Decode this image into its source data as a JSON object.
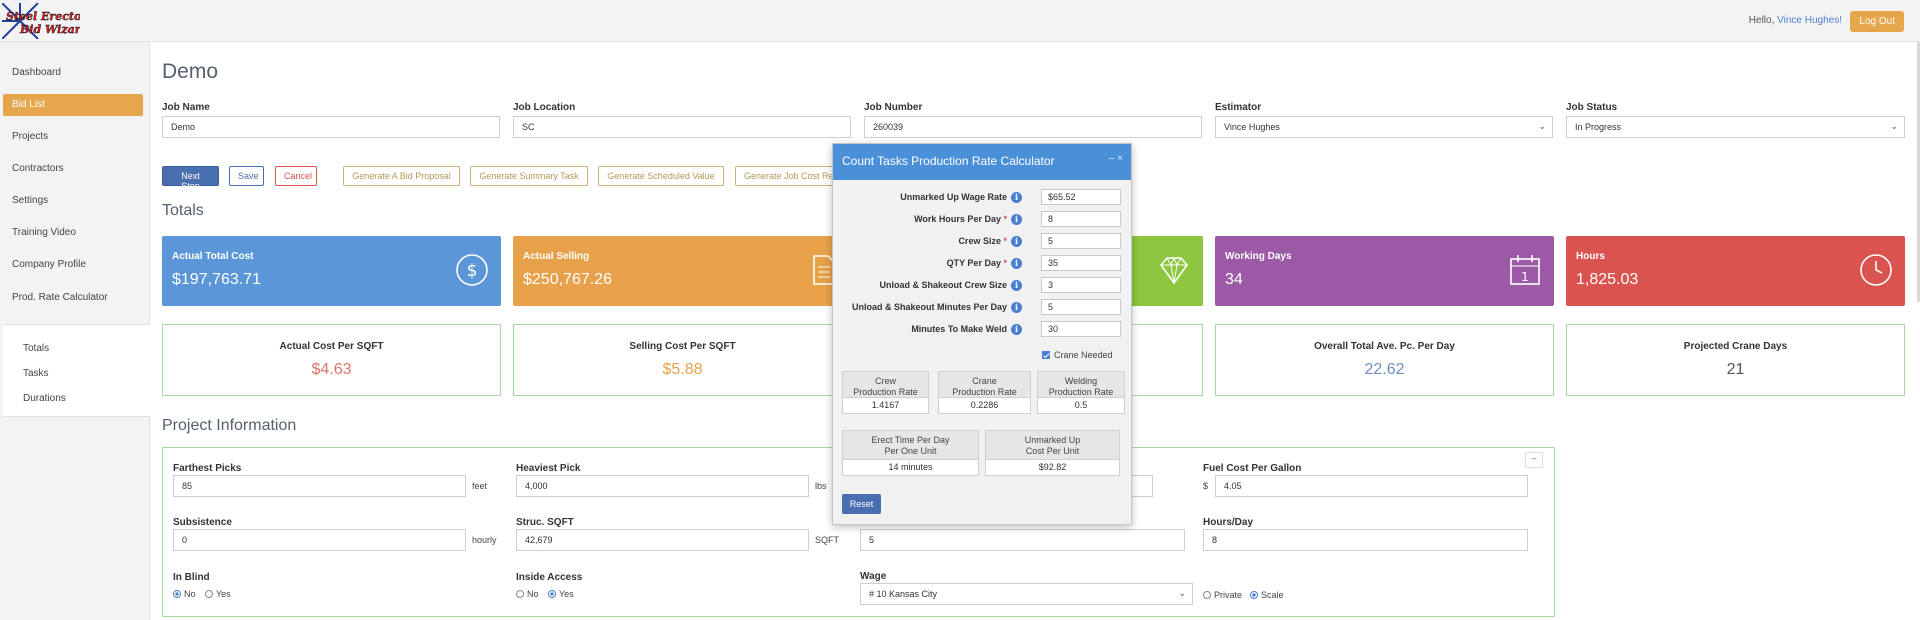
{
  "header": {
    "hello_prefix": "Hello, ",
    "user_name": "Vince Hughes!",
    "logout": "Log Out",
    "logo_text": "Steel Erectors Bid Wizard"
  },
  "sidebar": {
    "items": [
      {
        "label": "Dashboard"
      },
      {
        "label": "Bid List"
      },
      {
        "label": "Projects"
      },
      {
        "label": "Contractors"
      },
      {
        "label": "Settings"
      },
      {
        "label": "Training Video"
      },
      {
        "label": "Company Profile"
      },
      {
        "label": "Prod. Rate Calculator"
      }
    ],
    "sub_items": [
      {
        "label": "Totals"
      },
      {
        "label": "Tasks"
      },
      {
        "label": "Durations"
      }
    ]
  },
  "page": {
    "title": "Demo",
    "fields": {
      "job_name": {
        "label": "Job Name",
        "value": "Demo"
      },
      "job_location": {
        "label": "Job Location",
        "value": "SC"
      },
      "job_number": {
        "label": "Job Number",
        "value": "260039"
      },
      "estimator": {
        "label": "Estimator",
        "value": "Vince Hughes"
      },
      "job_status": {
        "label": "Job Status",
        "value": "In Progress"
      }
    },
    "buttons": {
      "next_step": "Next Step",
      "save": "Save",
      "cancel": "Cancel",
      "gen_bid": "Generate A Bid Proposal",
      "gen_summary": "Generate Summary Task",
      "gen_scheduled": "Generate Scheduled Value",
      "gen_job_cost": "Generate Job Cost Re"
    },
    "totals_title": "Totals",
    "cards": [
      {
        "title": "Actual Total Cost",
        "value": "$197,763.71",
        "color": "#5b97d8",
        "icon": "dollar-icon"
      },
      {
        "title": "Actual Selling",
        "value": "$250,767.26",
        "color": "#e6a14a",
        "icon": "document-icon"
      },
      {
        "title": "",
        "value": "",
        "color": "#8dc63f",
        "icon": "diamond-icon"
      },
      {
        "title": "Working Days",
        "value": "34",
        "color": "#9b59a6",
        "icon": "calendar-icon"
      },
      {
        "title": "Hours",
        "value": "1,825.03",
        "color": "#d9534f",
        "icon": "clock-icon"
      }
    ],
    "stats": [
      {
        "title": "Actual Cost Per SQFT",
        "value": "$4.63",
        "color": "#d9746a"
      },
      {
        "title": "Selling Cost Per SQFT",
        "value": "$5.88",
        "color": "#e6a14a"
      },
      {
        "title": "Overall Total Ave. Pc. Per Day",
        "value": "22.62",
        "color": "#6b8fbf"
      },
      {
        "title": "Projected Crane Days",
        "value": "21",
        "color": "#555555"
      }
    ],
    "project_info": {
      "title": "Project Information",
      "collapse": "–",
      "farthest_picks": {
        "label": "Farthest Picks",
        "value": "85",
        "unit": "feet"
      },
      "heaviest_pick": {
        "label": "Heaviest Pick",
        "value": "4,000",
        "unit": "lbs"
      },
      "fuel_cost": {
        "label": "Fuel Cost Per Gallon",
        "value": "4.05",
        "prefix": "$"
      },
      "subsistence": {
        "label": "Subsistence",
        "value": "0",
        "unit": "hourly"
      },
      "struc_sqft": {
        "label": "Struc. SQFT",
        "value": "42,679",
        "unit": "SQFT"
      },
      "third_value": {
        "value": "5"
      },
      "hours_day": {
        "label": "Hours/Day",
        "value": "8"
      },
      "in_blind": {
        "label": "In Blind",
        "no": "No",
        "yes": "Yes"
      },
      "inside_access": {
        "label": "Inside Access",
        "no": "No",
        "yes": "Yes"
      },
      "wage": {
        "label": "Wage",
        "value": "# 10 Kansas City",
        "private": "Private",
        "scale": "Scale"
      }
    }
  },
  "modal": {
    "title": "Count Tasks Production Rate Calculator",
    "controls": "– ×",
    "rows": [
      {
        "label": "Unmarked Up Wage Rate",
        "required": false,
        "value": "$65.52"
      },
      {
        "label": "Work Hours Per Day",
        "required": true,
        "value": "8"
      },
      {
        "label": "Crew Size",
        "required": true,
        "value": "5"
      },
      {
        "label": "QTY Per Day",
        "required": true,
        "value": "35"
      },
      {
        "label": "Unload & Shakeout Crew Size",
        "required": false,
        "value": "3"
      },
      {
        "label": "Unload & Shakeout Minutes Per Day",
        "required": false,
        "value": "5"
      },
      {
        "label": "Minutes To Make Weld",
        "required": false,
        "value": "30"
      }
    ],
    "crane_needed": "Crane Needed",
    "results": [
      {
        "l1": "Crew",
        "l2": "Production Rate",
        "value": "1.4167"
      },
      {
        "l1": "Crane",
        "l2": "Production Rate",
        "value": "0.2286"
      },
      {
        "l1": "Welding",
        "l2": "Production Rate",
        "value": "0.5"
      }
    ],
    "results2": [
      {
        "l1": "Erect Time Per Day",
        "l2": "Per One Unit",
        "value": "14 minutes"
      },
      {
        "l1": "Unmarked Up",
        "l2": "Cost Per Unit",
        "value": "$92.82"
      }
    ],
    "reset": "Reset"
  }
}
